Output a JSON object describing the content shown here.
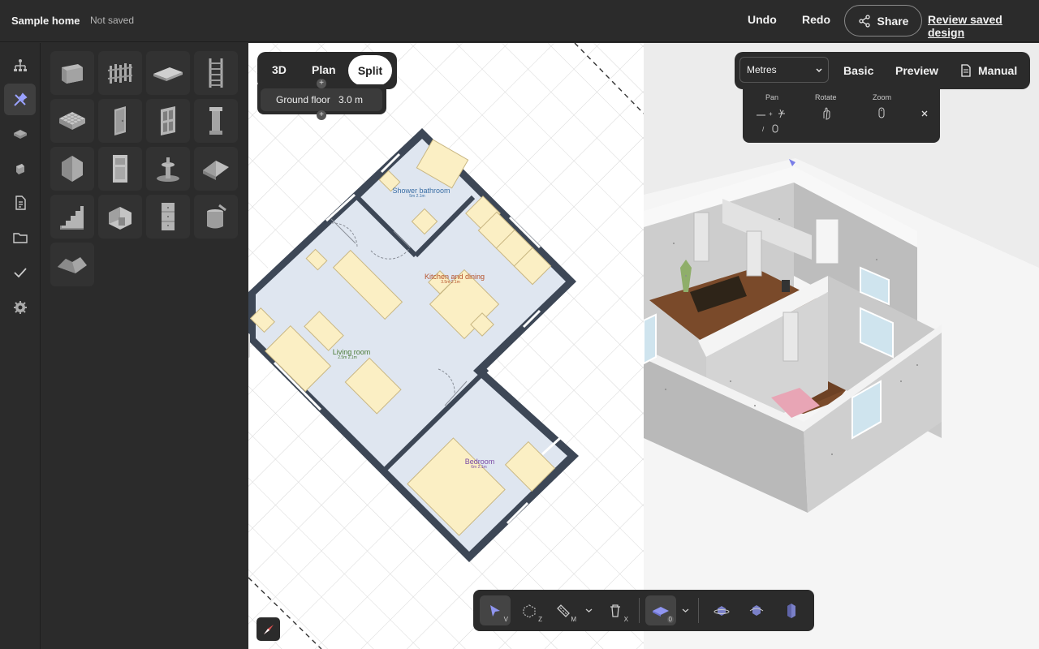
{
  "header": {
    "project_name": "Sample home",
    "save_status": "Not saved",
    "undo_label": "Undo",
    "redo_label": "Redo",
    "share_label": "Share",
    "review_label": "Review saved design"
  },
  "sidebar": {
    "items": [
      {
        "icon": "hierarchy-icon"
      },
      {
        "icon": "tools-icon",
        "active": true
      },
      {
        "icon": "materials-icon"
      },
      {
        "icon": "paint-icon"
      },
      {
        "icon": "document-icon"
      },
      {
        "icon": "folder-icon"
      },
      {
        "icon": "checkmark-icon"
      },
      {
        "icon": "settings-icon"
      }
    ]
  },
  "palette": {
    "items": [
      "wall",
      "fence",
      "floor-slab",
      "ladder",
      "ceiling-grid",
      "door",
      "window",
      "column",
      "shape",
      "appliance",
      "fountain",
      "roof",
      "stairs",
      "room-box",
      "cabinet",
      "paint-bucket",
      "terrain"
    ]
  },
  "view_tabs": {
    "tab_3d": "3D",
    "tab_plan": "Plan",
    "tab_split": "Split",
    "selected": "Split"
  },
  "floor": {
    "name": "Ground floor",
    "height": "3.0 m"
  },
  "plan": {
    "rooms": {
      "shower_bathroom": {
        "name": "Shower bathroom",
        "area": "5m 2.1m"
      },
      "kitchen_dining": {
        "name": "Kitchen and dining",
        "area": "3.5m 2.1m"
      },
      "living_room": {
        "name": "Living room",
        "area": "2.5m 2.1m"
      },
      "bedroom": {
        "name": "Bedroom",
        "area": "6m 2.1m"
      }
    }
  },
  "right_toolbar": {
    "units": "Metres",
    "basic_label": "Basic",
    "preview_label": "Preview",
    "manual_label": "Manual"
  },
  "nav_help": {
    "pan_label": "Pan",
    "rotate_label": "Rotate",
    "zoom_label": "Zoom"
  },
  "bottom_tools": {
    "select_key": "V",
    "box_key": "Z",
    "measure_key": "M",
    "delete_key": "X",
    "floor_count": "0"
  },
  "colors": {
    "accent": "#7a7ee8",
    "room_fill": "#dfe6f0",
    "furniture": "#fbefc4",
    "wall": "#3d4756"
  }
}
